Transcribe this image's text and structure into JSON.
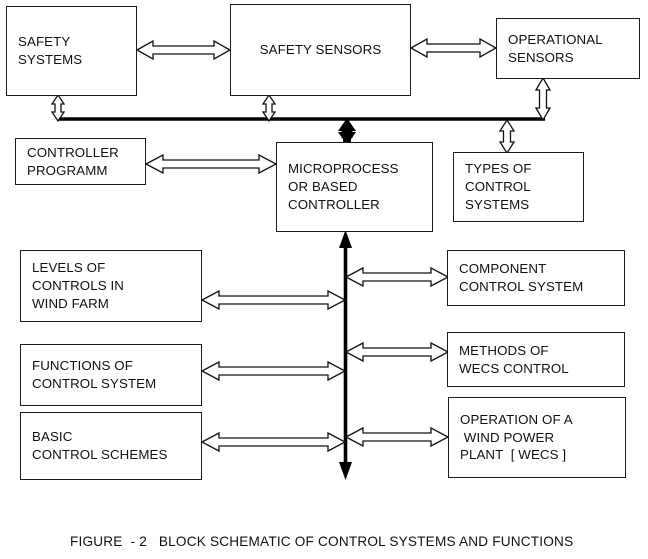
{
  "figure": {
    "caption": "FIGURE  - 2   BLOCK SCHEMATIC OF CONTROL SYSTEMS AND FUNCTIONS",
    "line_color": "#111111",
    "fill_color": "#ffffff",
    "background": "#ffffff"
  },
  "blocks": {
    "safety_systems": {
      "line1": "SAFETY",
      "line2": "SYSTEMS"
    },
    "safety_sensors": {
      "line1": "SAFETY SENSORS"
    },
    "operational_sensors": {
      "line1": "OPERATIONAL",
      "line2": "SENSORS"
    },
    "controller_programm": {
      "line1": "CONTROLLER",
      "line2": "PROGRAMM"
    },
    "microprocessor_controller": {
      "line1": "MICROPROCESS",
      "line2": "OR BASED",
      "line3": "CONTROLLER"
    },
    "types_of_control_systems": {
      "line1": "TYPES OF",
      "line2": "CONTROL",
      "line3": "SYSTEMS"
    },
    "levels_of_controls": {
      "line1": "LEVELS OF",
      "line2": "CONTROLS IN",
      "line3": "WIND FARM"
    },
    "functions_of_control_system": {
      "line1": "FUNCTIONS OF",
      "line2": "CONTROL SYSTEM"
    },
    "basic_control_schemes": {
      "line1": "BASIC",
      "line2": "CONTROL SCHEMES"
    },
    "component_control_system": {
      "line1": "COMPONENT",
      "line2": "CONTROL SYSTEM"
    },
    "methods_of_wecs_control": {
      "line1": "METHODS OF",
      "line2": "WECS CONTROL"
    },
    "operation_of_wind_power_plant": {
      "line1": "OPERATION OF A",
      "line2": " WIND POWER",
      "line3": "PLANT  [ WECS ]"
    }
  },
  "connectors": {
    "safety_systems_to_safety_sensors": "double-headed-horizontal-arrow",
    "safety_sensors_to_operational_sensors": "double-headed-horizontal-arrow",
    "safety_systems_to_bus": "double-headed-vertical-arrow",
    "safety_sensors_to_bus": "double-headed-vertical-arrow",
    "operational_sensors_to_bus": "double-headed-vertical-arrow",
    "bus_to_types_of_control_systems": "double-headed-vertical-arrow",
    "bus_to_microprocessor": "thick-double-headed-vertical-arrow",
    "controller_programm_to_microprocessor": "double-headed-horizontal-arrow",
    "levels_of_controls_to_spine": "double-headed-horizontal-arrow",
    "functions_of_control_system_to_spine": "double-headed-horizontal-arrow",
    "basic_control_schemes_to_spine": "double-headed-horizontal-arrow",
    "spine_to_component_control_system": "double-headed-horizontal-arrow",
    "spine_to_methods_of_wecs_control": "double-headed-horizontal-arrow",
    "spine_to_operation_of_wind_power_plant": "double-headed-horizontal-arrow",
    "horizontal_bus": "thick-horizontal-bus-line",
    "vertical_spine": "thick-double-headed-vertical-spine"
  }
}
